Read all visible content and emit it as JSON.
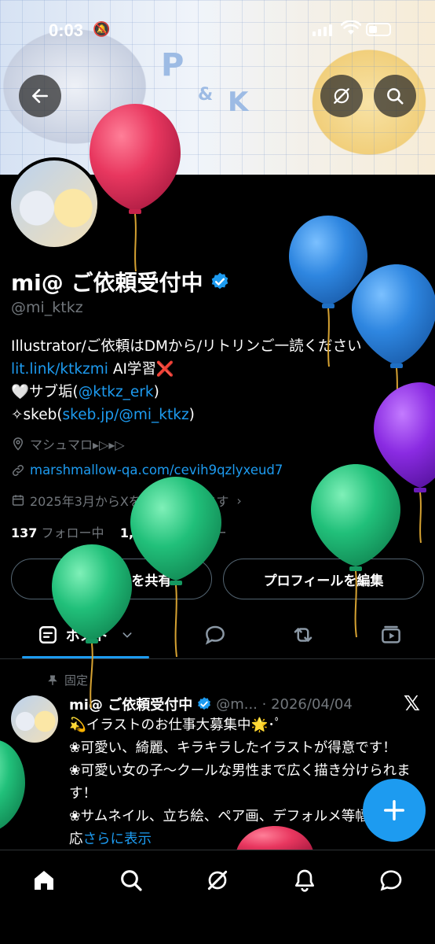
{
  "status_bar": {
    "time": "0:03"
  },
  "profile": {
    "name": "mi@ ご依頼受付中",
    "handle": "@mi_ktkz",
    "bio_lines": [
      "Illustrator/ご依頼はDMから/リトリンご一読ください",
      "AI学習❌",
      "🤍サブ垢(",
      ")",
      "✧skeb("
    ],
    "bio_links": {
      "litlink": "lit.link/ktkzmi",
      "sub_account": "@ktkz_erk",
      "skeb": "skeb.jp/@mi_ktkz"
    },
    "location": "マシュマロ▸▷▸▷",
    "website": "marshmallow-qa.com/cevih9qzlyxeud7",
    "joined": "2025年3月からXを利用しています",
    "following_count": "137",
    "following_label": "フォロー中",
    "followers_count": "1,436",
    "followers_label": "フォロワー"
  },
  "buttons": {
    "share": "プロフィールを共有",
    "edit": "プロフィールを編集"
  },
  "tabs": {
    "posts": "ポスト"
  },
  "pinned_post": {
    "pinned_label": "固定",
    "author": "mi@ ご依頼受付中",
    "handle_date": "@m... · 2026/04/04",
    "lines": [
      "💫イラストのお仕事大募集中🌟･ﾟ",
      "❀可愛い、綺麗、キラキラしたイラストが得意です！",
      "❀可愛い女の子〜クールな男性まで広く描き分けられます！",
      "❀サムネイル、立ち絵、ペア画、デフォルメ等幅広くご対応"
    ],
    "show_more": "さらに表示"
  },
  "colors": {
    "accent": "#1d9bf0",
    "background": "#000000",
    "muted": "#71767b",
    "balloon_red": "#e8375f",
    "balloon_blue": "#2e86e0",
    "balloon_purple": "#8a2be2",
    "balloon_green": "#21c07a"
  }
}
